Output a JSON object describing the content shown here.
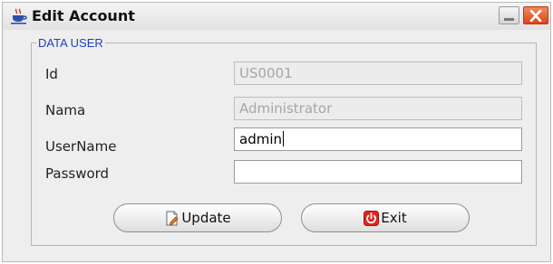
{
  "window": {
    "title": "Edit Account",
    "title_icon": "java-cup-icon",
    "minimize_icon": "minimize-icon",
    "close_icon": "close-icon"
  },
  "group": {
    "legend": "DATA USER"
  },
  "fields": [
    {
      "label": "Id",
      "value": "US0001",
      "enabled": false
    },
    {
      "label": "Nama",
      "value": "Administrator",
      "enabled": false
    },
    {
      "label": "UserName",
      "value": "admin",
      "enabled": true
    },
    {
      "label": "Password",
      "value": "",
      "enabled": true
    }
  ],
  "buttons": {
    "update_label": "Update",
    "update_icon": "document-edit-icon",
    "exit_label": "Exit",
    "exit_icon": "power-icon"
  },
  "colors": {
    "legend": "#1f3fbf",
    "close_button": "#d9461b",
    "disabled_text": "#a6a6a6"
  }
}
